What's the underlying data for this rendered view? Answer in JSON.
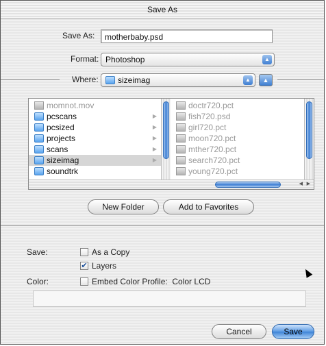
{
  "window": {
    "title": "Save As"
  },
  "save_as": {
    "label": "Save As:",
    "value": "motherbaby.psd"
  },
  "format": {
    "label": "Format:",
    "value": "Photoshop"
  },
  "where": {
    "label": "Where:",
    "value": "sizeimag"
  },
  "browser": {
    "column1": [
      {
        "name": "momnot.mov",
        "kind": "file",
        "state": "dim"
      },
      {
        "name": "pcscans",
        "kind": "folder",
        "state": "normal"
      },
      {
        "name": "pcsized",
        "kind": "folder",
        "state": "normal"
      },
      {
        "name": "projects",
        "kind": "folder",
        "state": "normal"
      },
      {
        "name": "scans",
        "kind": "folder",
        "state": "normal"
      },
      {
        "name": "sizeimag",
        "kind": "folder",
        "state": "selected"
      },
      {
        "name": "soundtrk",
        "kind": "folder",
        "state": "normal"
      }
    ],
    "column2": [
      {
        "name": "doctr720.pct",
        "kind": "file"
      },
      {
        "name": "fish720.psd",
        "kind": "file"
      },
      {
        "name": "girl720.pct",
        "kind": "file"
      },
      {
        "name": "moon720.pct",
        "kind": "file"
      },
      {
        "name": "mther720.pct",
        "kind": "file"
      },
      {
        "name": "search720.pct",
        "kind": "file"
      },
      {
        "name": "young720.pct",
        "kind": "file"
      }
    ]
  },
  "buttons": {
    "new_folder": "New Folder",
    "add_favorites": "Add to Favorites",
    "cancel": "Cancel",
    "save": "Save"
  },
  "options": {
    "save_label": "Save:",
    "as_copy": {
      "label": "As a Copy",
      "checked": false
    },
    "layers": {
      "label": "Layers",
      "checked": true
    },
    "color_label": "Color:",
    "embed_profile": {
      "label": "Embed Color Profile:  Color LCD",
      "checked": false
    }
  },
  "colors": {
    "accent": "#3b82d6",
    "selection": "#d6d6d6"
  }
}
